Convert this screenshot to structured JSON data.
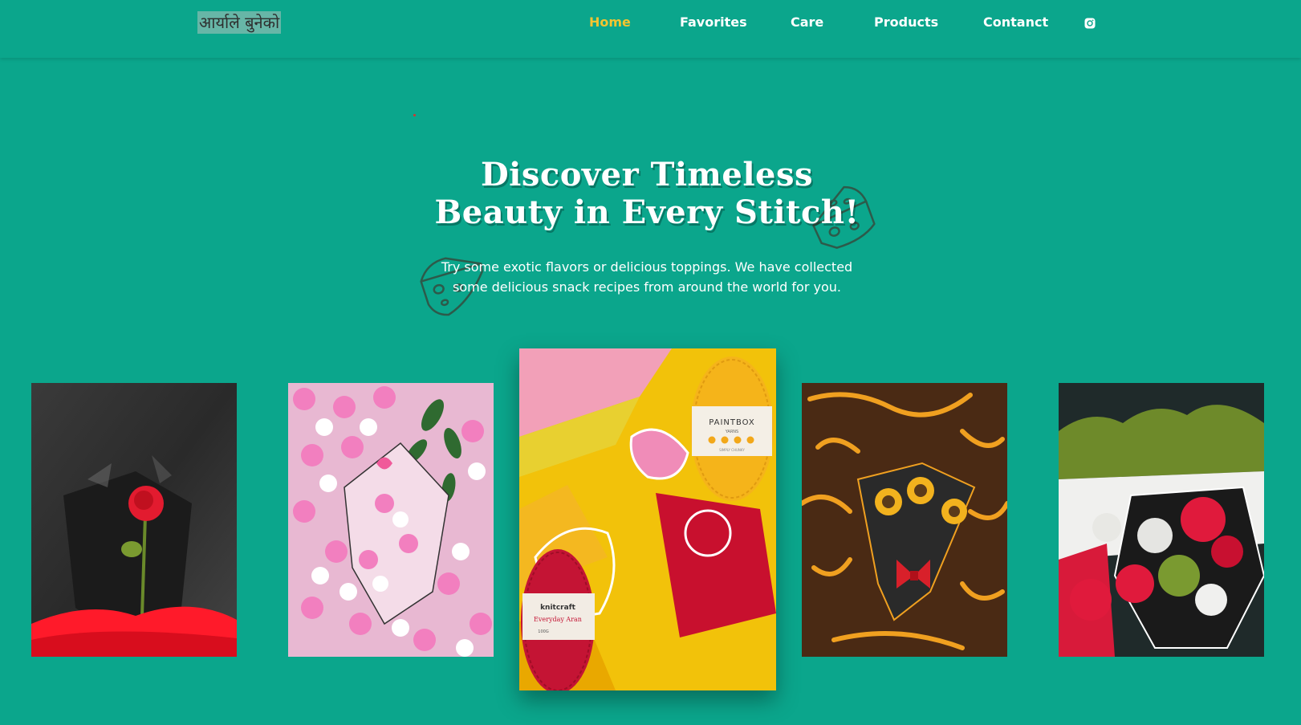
{
  "header": {
    "logo": "आर्याले बुनेको"
  },
  "nav": {
    "items": [
      {
        "label": "Home",
        "active": true
      },
      {
        "label": "Favorites",
        "active": false
      },
      {
        "label": "Care",
        "active": false
      },
      {
        "label": "Products",
        "active": false
      },
      {
        "label": "Contanct",
        "active": false
      }
    ],
    "social_icon": "instagram-icon"
  },
  "hero": {
    "title_line1": "Discover Timeless",
    "title_line2": "Beauty in Every Stitch!",
    "subtitle_line1": "Try some exotic flavors or delicious toppings. We have collected",
    "subtitle_line2": "some delicious snack recipes from around the world for you."
  },
  "gallery": {
    "images": [
      {
        "subject": "red crochet rose bouquet"
      },
      {
        "subject": "pink and white crochet lily bouquet"
      },
      {
        "subject": "crochet blanket with yarn skeins"
      },
      {
        "subject": "crochet sunflower bouquet"
      },
      {
        "subject": "red and white crochet carnation bouquet"
      }
    ],
    "yarn_labels": {
      "paintbox_brand": "PAINTBOX",
      "paintbox_line": "YARNS",
      "paintbox_sub": "SIMPLY CHUNKY",
      "knitcraft_brand": "knitcraft",
      "knitcraft_line": "Everyday Aran",
      "knitcraft_weight": "100G"
    }
  },
  "colors": {
    "background": "#0ba68c",
    "nav_active": "#f4c430",
    "text": "#ffffff"
  }
}
